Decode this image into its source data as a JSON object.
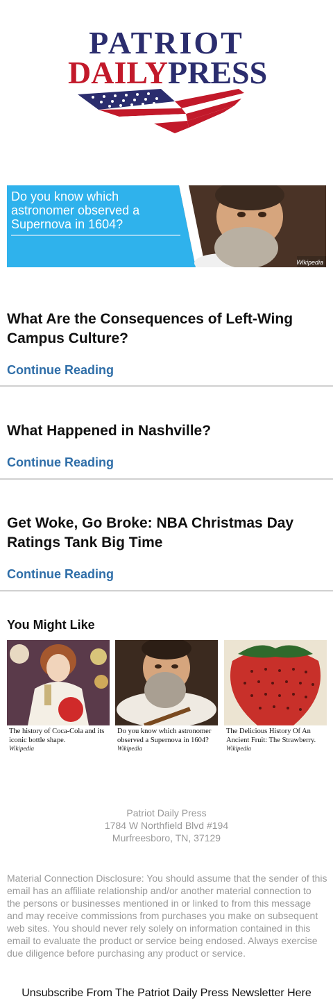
{
  "logo": {
    "line1": "PATRIOT",
    "daily": "DAILY",
    "press": "PRESS",
    "colors": {
      "navy": "#2b2d6e",
      "red": "#c2192a"
    }
  },
  "banner": {
    "text": "Do you know which astronomer observed a Supernova in 1604?",
    "source": "Wikipedia",
    "accent": "#2fb2ec"
  },
  "articles": [
    {
      "title": "What Are the Consequences of Left-Wing Campus Culture?",
      "link": "Continue Reading"
    },
    {
      "title": "What Happened in Nashville?",
      "link": "Continue Reading"
    },
    {
      "title": "Get Woke, Go Broke: NBA Christmas Day Ratings Tank Big Time",
      "link": "Continue Reading"
    }
  ],
  "you_might_like": {
    "heading": "You Might Like",
    "cards": [
      {
        "caption": "The history of Coca-Cola and its iconic bottle shape.",
        "source": "Wikipedia",
        "image_icon": "coca-cola-girl-image"
      },
      {
        "caption": "Do you know which astronomer observed a Supernova in 1604?",
        "source": "Wikipedia",
        "image_icon": "astronomer-portrait-image"
      },
      {
        "caption": "The Delicious History Of An Ancient Fruit: The Strawberry.",
        "source": "Wikipedia",
        "image_icon": "strawberry-image"
      }
    ]
  },
  "footer": {
    "company": "Patriot Daily Press",
    "street": "1784 W Northfield Blvd #194",
    "city": "Murfreesboro, TN, 37129",
    "disclosure": "Material Connection Disclosure: You should assume that the sender of this email has an affiliate relationship and/or another material connection to the persons or businesses mentioned in or linked to from this message and may receive commissions from purchases you make on subsequent web sites. You should never rely solely on information contained in this email to evaluate the product or service being endosed. Always exercise due diligence before purchasing any product or service.",
    "unsubscribe": "Unsubscribe From The Patriot Daily Press Newsletter Here"
  }
}
